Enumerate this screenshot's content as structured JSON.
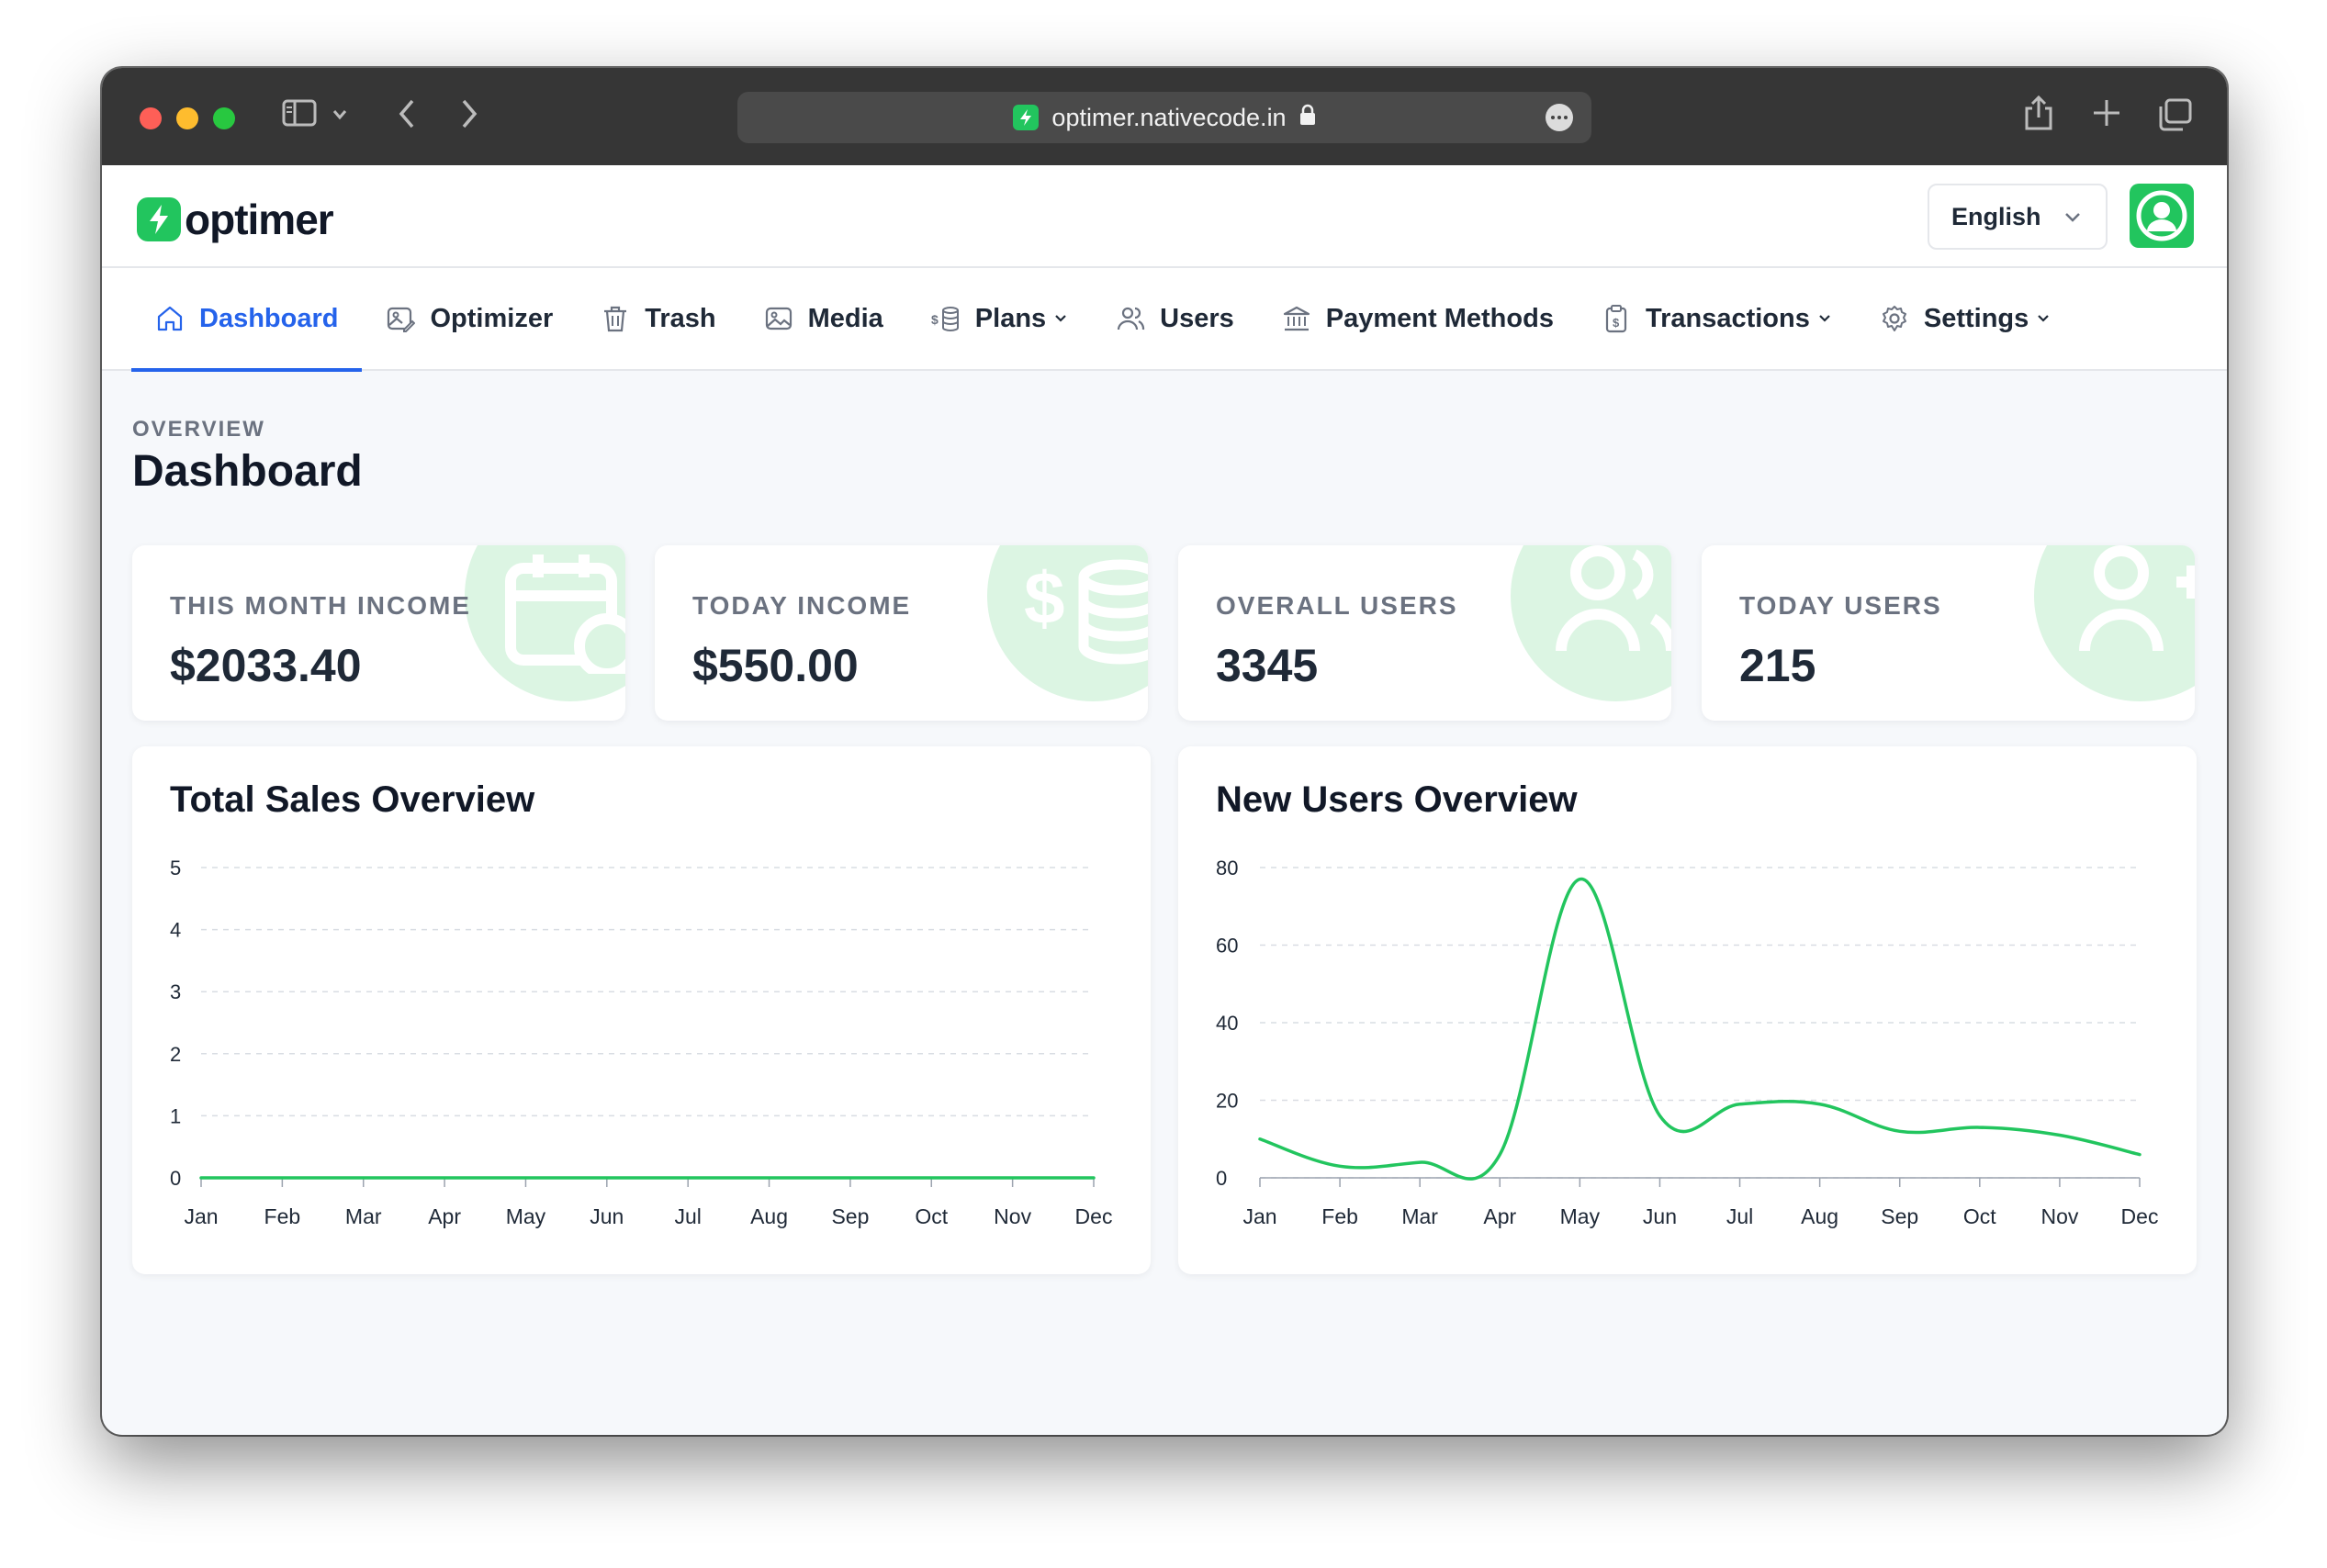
{
  "browser": {
    "url": "optimer.nativecode.in"
  },
  "header": {
    "logo_text": "optimer",
    "language": "English"
  },
  "nav": [
    {
      "label": "Dashboard",
      "icon": "home-icon",
      "active": true,
      "caret": false
    },
    {
      "label": "Optimizer",
      "icon": "image-edit-icon",
      "active": false,
      "caret": false
    },
    {
      "label": "Trash",
      "icon": "trash-icon",
      "active": false,
      "caret": false
    },
    {
      "label": "Media",
      "icon": "image-icon",
      "active": false,
      "caret": false
    },
    {
      "label": "Plans",
      "icon": "coins-icon",
      "active": false,
      "caret": true
    },
    {
      "label": "Users",
      "icon": "users-icon",
      "active": false,
      "caret": false
    },
    {
      "label": "Payment Methods",
      "icon": "bank-icon",
      "active": false,
      "caret": false
    },
    {
      "label": "Transactions",
      "icon": "receipt-icon",
      "active": false,
      "caret": true
    },
    {
      "label": "Settings",
      "icon": "gear-icon",
      "active": false,
      "caret": true
    }
  ],
  "page": {
    "overline": "OVERVIEW",
    "title": "Dashboard"
  },
  "stats": [
    {
      "label": "THIS MONTH INCOME",
      "value": "$2033.40",
      "icon": "calendar-clock-icon"
    },
    {
      "label": "TODAY INCOME",
      "value": "$550.00",
      "icon": "dollar-coins-icon"
    },
    {
      "label": "OVERALL USERS",
      "value": "3345",
      "icon": "users-icon"
    },
    {
      "label": "TODAY USERS",
      "value": "215",
      "icon": "user-plus-icon"
    }
  ],
  "colors": {
    "accent": "#2563eb",
    "brand": "#22c55e",
    "bubble": "#dcf5e3"
  },
  "chart_data": [
    {
      "type": "line",
      "title": "Total Sales Overview",
      "categories": [
        "Jan",
        "Feb",
        "Mar",
        "Apr",
        "May",
        "Jun",
        "Jul",
        "Aug",
        "Sep",
        "Oct",
        "Nov",
        "Dec"
      ],
      "values": [
        0,
        0,
        0,
        0,
        0,
        0,
        0,
        0,
        0,
        0,
        0,
        0
      ],
      "ylim": [
        0,
        5
      ],
      "yticks": [
        0,
        1,
        2,
        3,
        4,
        5
      ],
      "grid": true,
      "color": "#22c55e"
    },
    {
      "type": "line",
      "title": "New Users Overview",
      "categories": [
        "Jan",
        "Feb",
        "Mar",
        "Apr",
        "May",
        "Jun",
        "Jul",
        "Aug",
        "Sep",
        "Oct",
        "Nov",
        "Dec"
      ],
      "values": [
        10,
        3,
        4,
        6,
        77,
        16,
        19,
        19,
        12,
        13,
        11,
        6
      ],
      "ylim": [
        0,
        80
      ],
      "yticks": [
        0,
        20,
        40,
        60,
        80
      ],
      "grid": true,
      "color": "#22c55e"
    }
  ]
}
